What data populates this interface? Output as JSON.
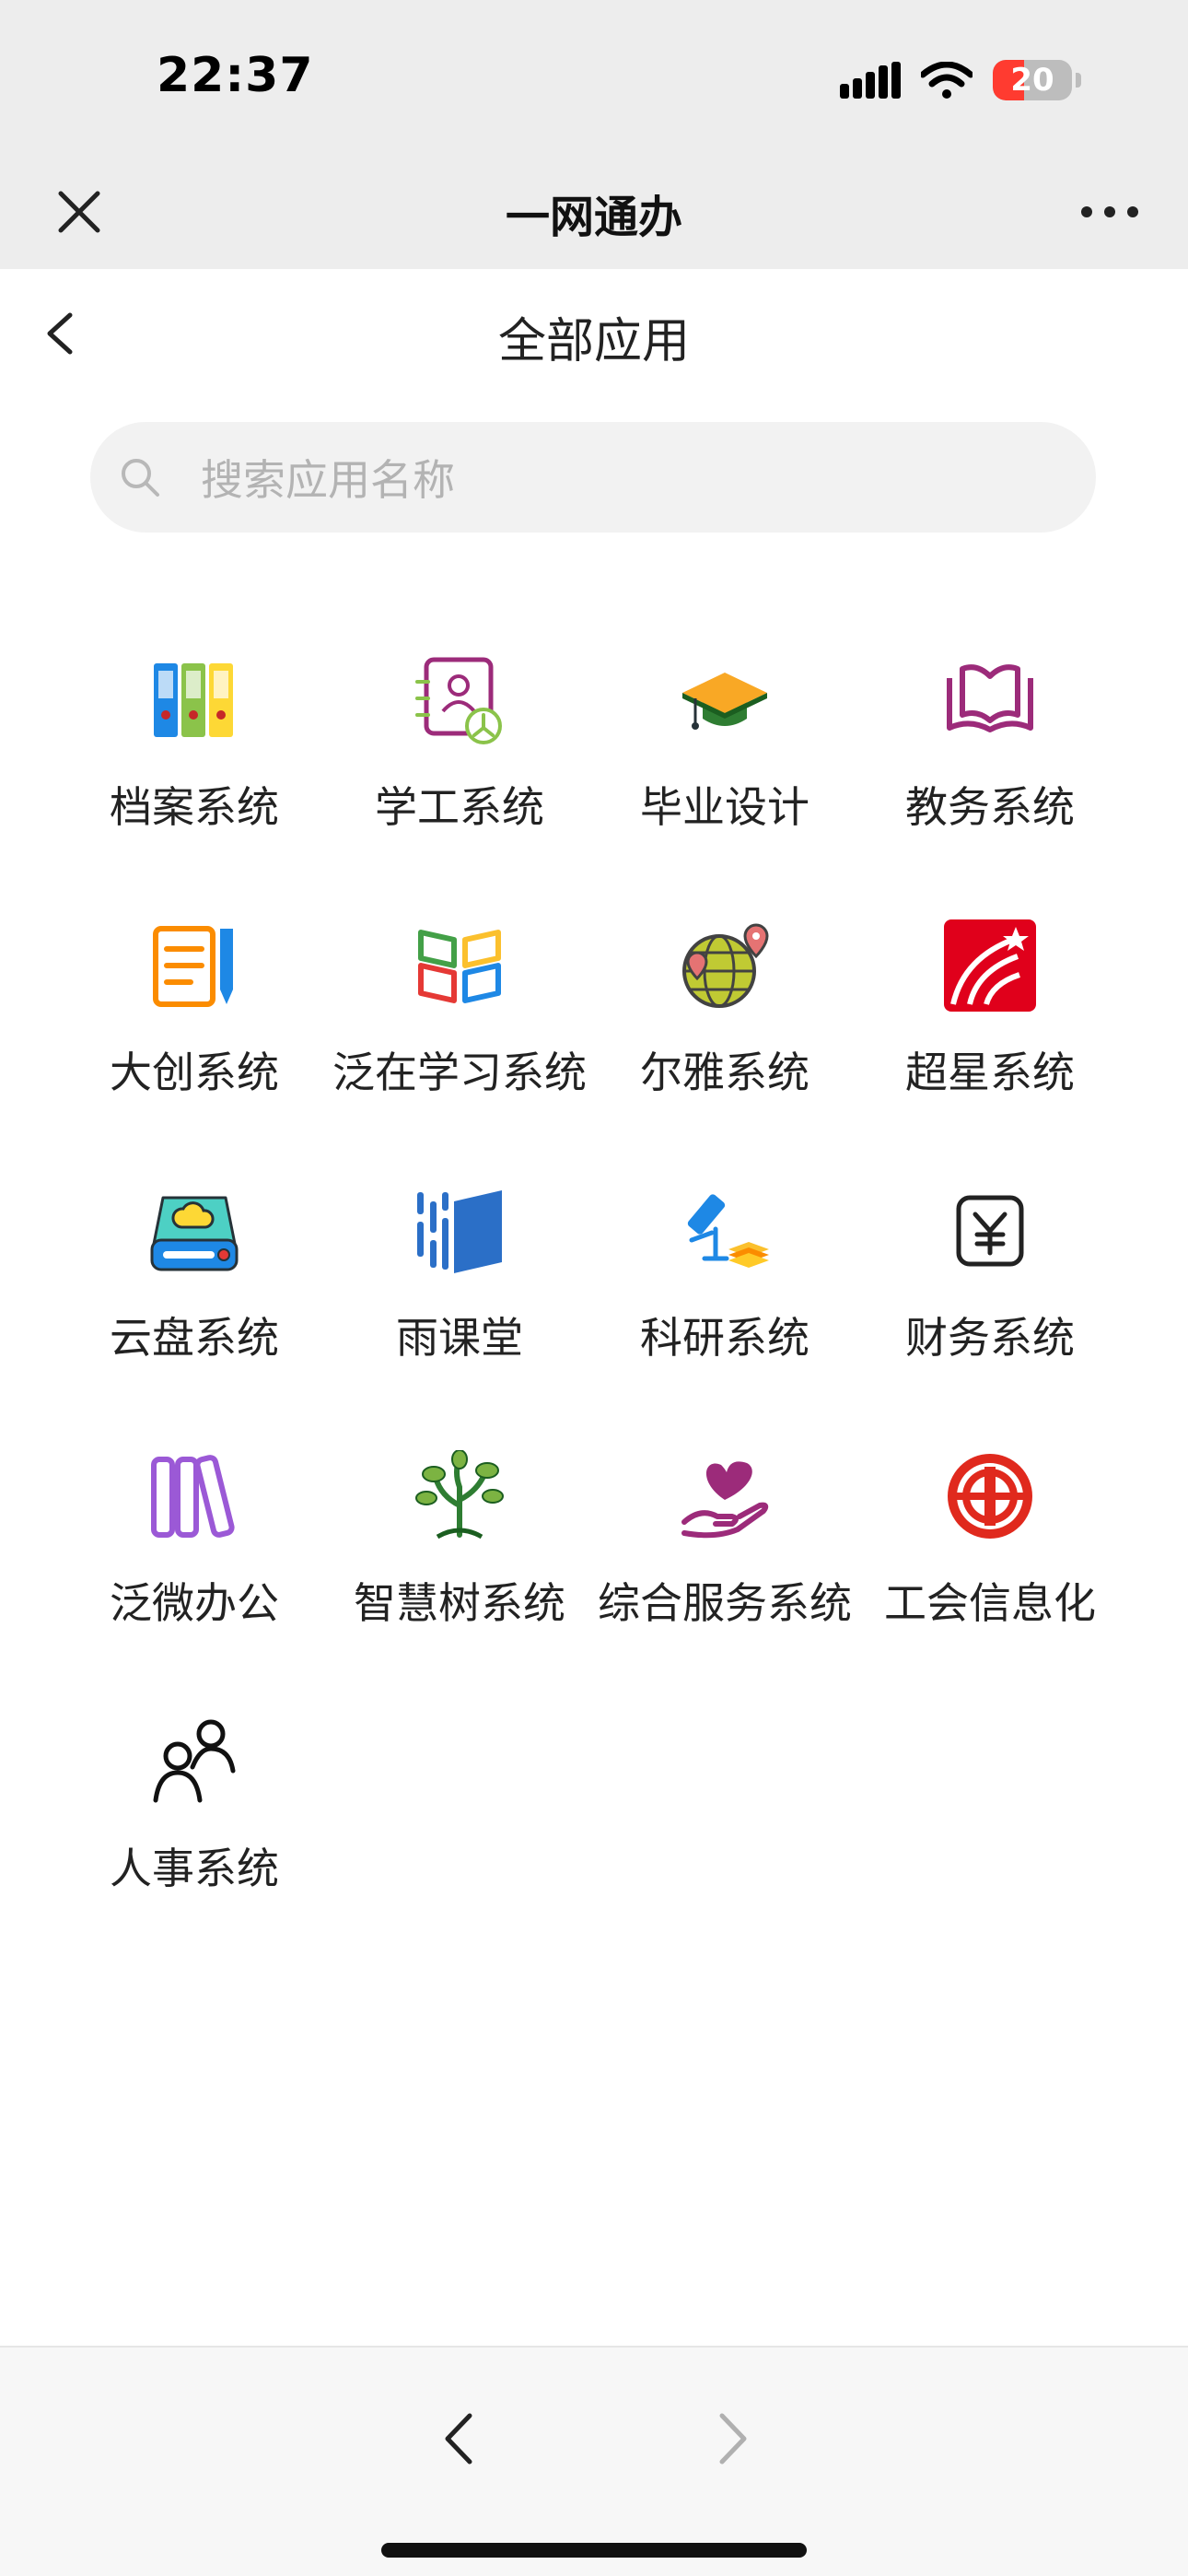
{
  "status": {
    "time": "22:37",
    "battery": "20",
    "battery_level": 0.2,
    "battery_color": "#ff3b30"
  },
  "navbar": {
    "title": "一网通办",
    "close_icon": "close-icon",
    "more_icon": "more-icon"
  },
  "page": {
    "title": "全部应用"
  },
  "search": {
    "placeholder": "搜索应用名称"
  },
  "apps": [
    {
      "label": "档案系统",
      "icon": "binders-icon"
    },
    {
      "label": "学工系统",
      "icon": "student-profile-icon"
    },
    {
      "label": "毕业设计",
      "icon": "graduation-cap-icon"
    },
    {
      "label": "教务系统",
      "icon": "open-book-icon"
    },
    {
      "label": "大创系统",
      "icon": "notepad-pencil-icon"
    },
    {
      "label": "泛在学习系统",
      "icon": "colorful-book-icon"
    },
    {
      "label": "尔雅系统",
      "icon": "globe-pin-icon"
    },
    {
      "label": "超星系统",
      "icon": "chaoxing-logo-icon"
    },
    {
      "label": "云盘系统",
      "icon": "cloud-drive-icon"
    },
    {
      "label": "雨课堂",
      "icon": "rain-classroom-icon"
    },
    {
      "label": "科研系统",
      "icon": "microscope-icon"
    },
    {
      "label": "财务系统",
      "icon": "yuan-icon"
    },
    {
      "label": "泛微办公",
      "icon": "books-icon"
    },
    {
      "label": "智慧树系统",
      "icon": "tree-icon"
    },
    {
      "label": "综合服务系统",
      "icon": "heart-hand-icon"
    },
    {
      "label": "工会信息化",
      "icon": "union-logo-icon"
    },
    {
      "label": "人事系统",
      "icon": "people-icon"
    }
  ]
}
